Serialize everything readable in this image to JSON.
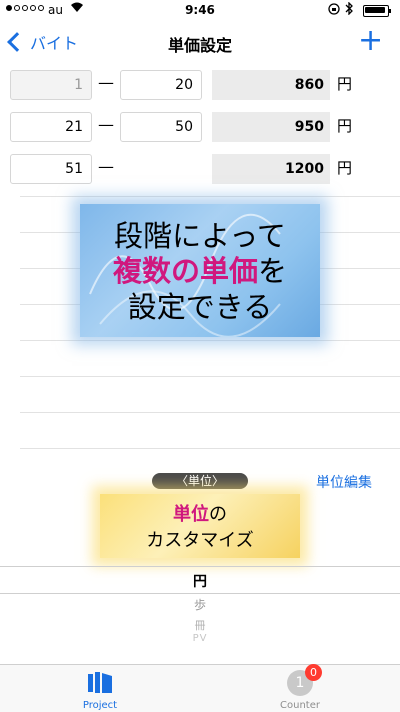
{
  "status_bar": {
    "carrier": "au",
    "time": "9:46",
    "wifi_icon": "wifi-icon",
    "battery_icon": "battery-icon"
  },
  "nav": {
    "back_label": "バイト",
    "title": "単価設定",
    "add_label": "+"
  },
  "price_rows": [
    {
      "from": "1",
      "to": "20",
      "price": "860",
      "unit": "円"
    },
    {
      "from": "21",
      "to": "50",
      "price": "950",
      "unit": "円"
    },
    {
      "from": "51",
      "to": "",
      "price": "1200",
      "unit": "円"
    }
  ],
  "range_separator": "—",
  "promo_tiers": {
    "line1": "段階によって",
    "line2_highlight": "複数の単価",
    "line2_suffix": "を",
    "line3": "設定できる"
  },
  "unit_section": {
    "header": "〈単位〉",
    "edit_label": "単位編集"
  },
  "promo_unit": {
    "highlight": "単位",
    "suffix": "の",
    "line2": "カスタマイズ"
  },
  "unit_picker": {
    "options": [
      "円",
      "歩",
      "冊",
      "PV"
    ],
    "selected": "円"
  },
  "tab_bar": {
    "project_label": "Project",
    "counter_label": "Counter",
    "counter_value": "1",
    "counter_badge": "0"
  },
  "colors": {
    "accent": "#1a6fe0",
    "highlight_text": "#d0187e",
    "badge": "#ff3b30"
  }
}
